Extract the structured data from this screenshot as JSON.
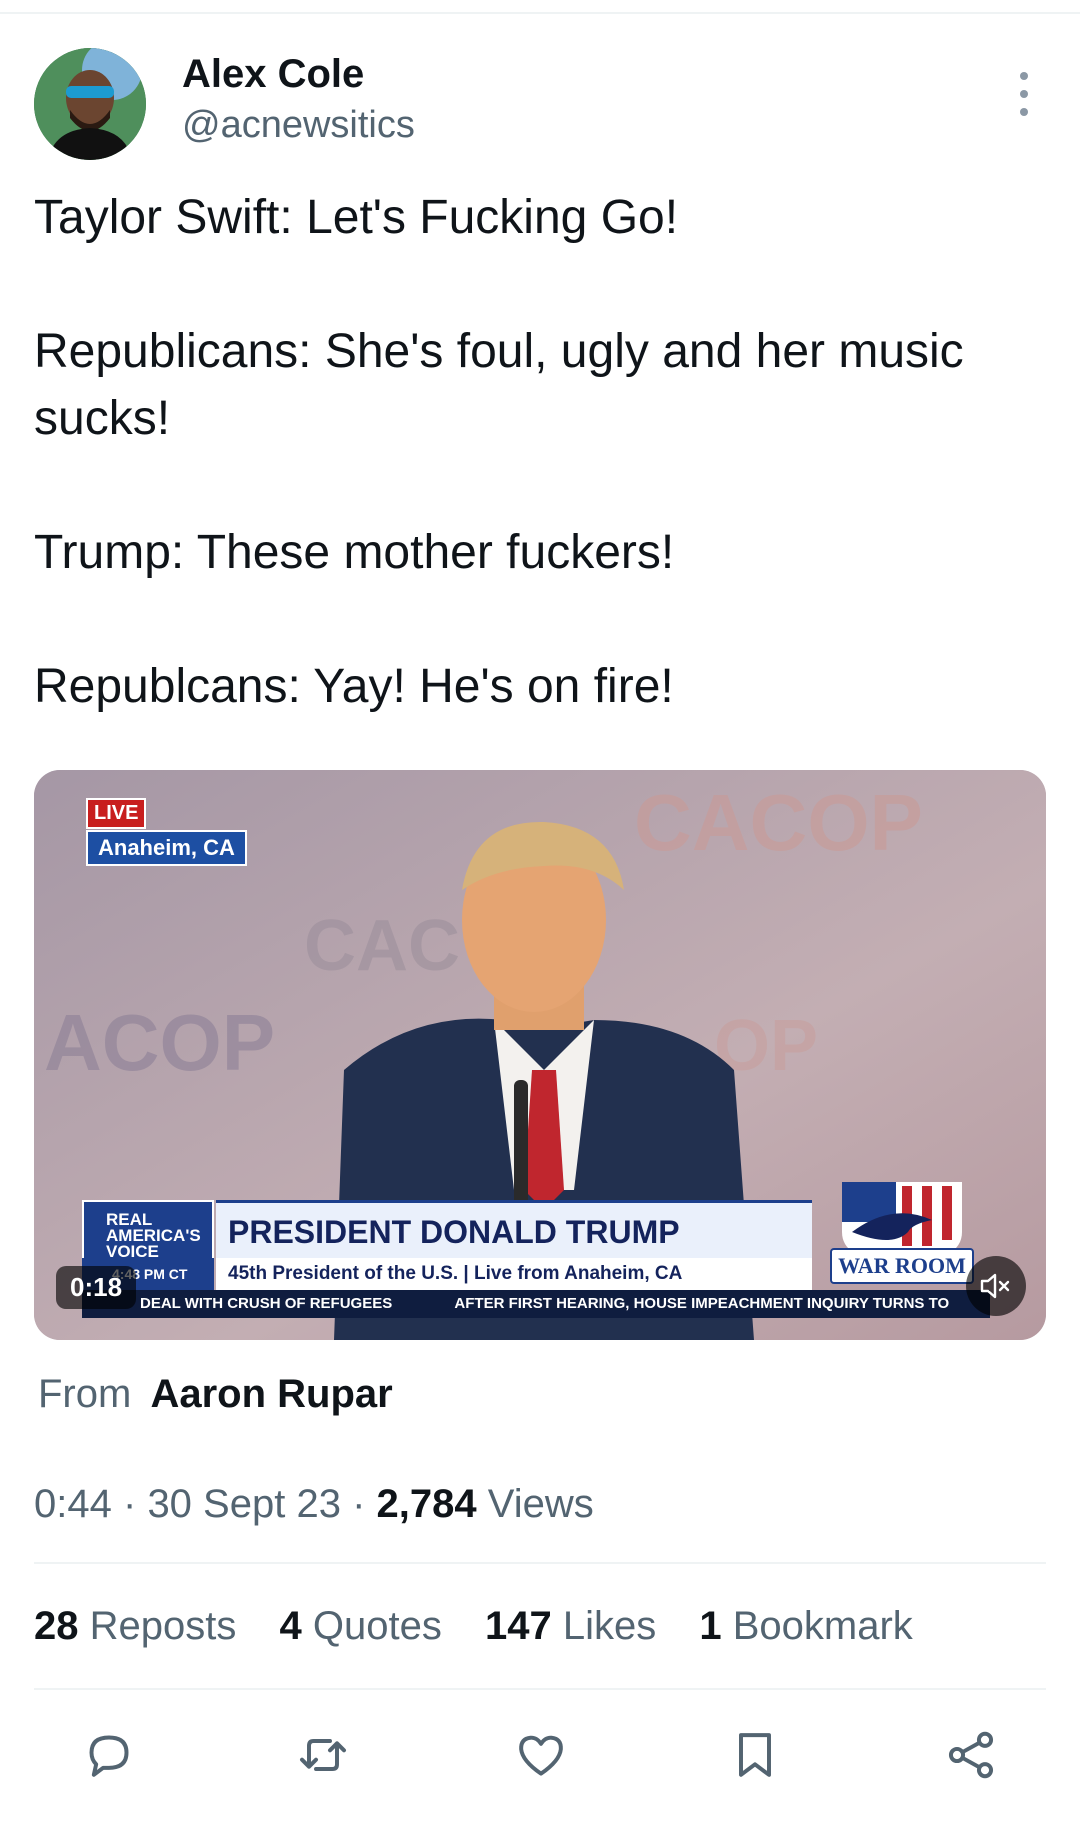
{
  "author": {
    "name": "Alex Cole",
    "handle": "@acnewsitics"
  },
  "tweet": {
    "lines": [
      "Taylor Swift: Let's Fucking Go!",
      "Republicans: She's foul, ugly and her music sucks!",
      "Trump: These mother fuckers!",
      "Republcans: Yay! He's on fire!"
    ]
  },
  "video": {
    "duration": "0:18",
    "live_badge": "LIVE",
    "location": "Anaheim, CA",
    "channel_logo": "REAL AMERICA'S VOICE",
    "headline": "PRESIDENT DONALD TRUMP",
    "subline": "45th President of the U.S. | Live from Anaheim, CA",
    "time_label": "4:48 PM CT",
    "brand": "WAR ROOM",
    "ticker_1": "DEAL WITH CRUSH OF REFUGEES",
    "ticker_2": "AFTER FIRST HEARING, HOUSE IMPEACHMENT INQUIRY TURNS TO",
    "backdrop_text": "CACOP",
    "muted": true
  },
  "source": {
    "prefix": "From",
    "name": "Aaron Rupar"
  },
  "meta": {
    "time": "0:44",
    "sep1": "·",
    "date": "30 Sept 23",
    "sep2": "·",
    "views_count": "2,784",
    "views_label": "Views"
  },
  "stats": {
    "reposts_count": "28",
    "reposts_label": "Reposts",
    "quotes_count": "4",
    "quotes_label": "Quotes",
    "likes_count": "147",
    "likes_label": "Likes",
    "bookmarks_count": "1",
    "bookmarks_label": "Bookmark"
  },
  "colors": {
    "text": "#0f1419",
    "secondary": "#536471",
    "divider": "#eff3f4",
    "icon": "#536471"
  },
  "icons": {
    "more": "more-vertical-icon",
    "reply": "reply-icon",
    "repost": "repost-icon",
    "like": "heart-icon",
    "bookmark": "bookmark-icon",
    "share": "share-icon",
    "mute": "volume-muted-icon"
  }
}
